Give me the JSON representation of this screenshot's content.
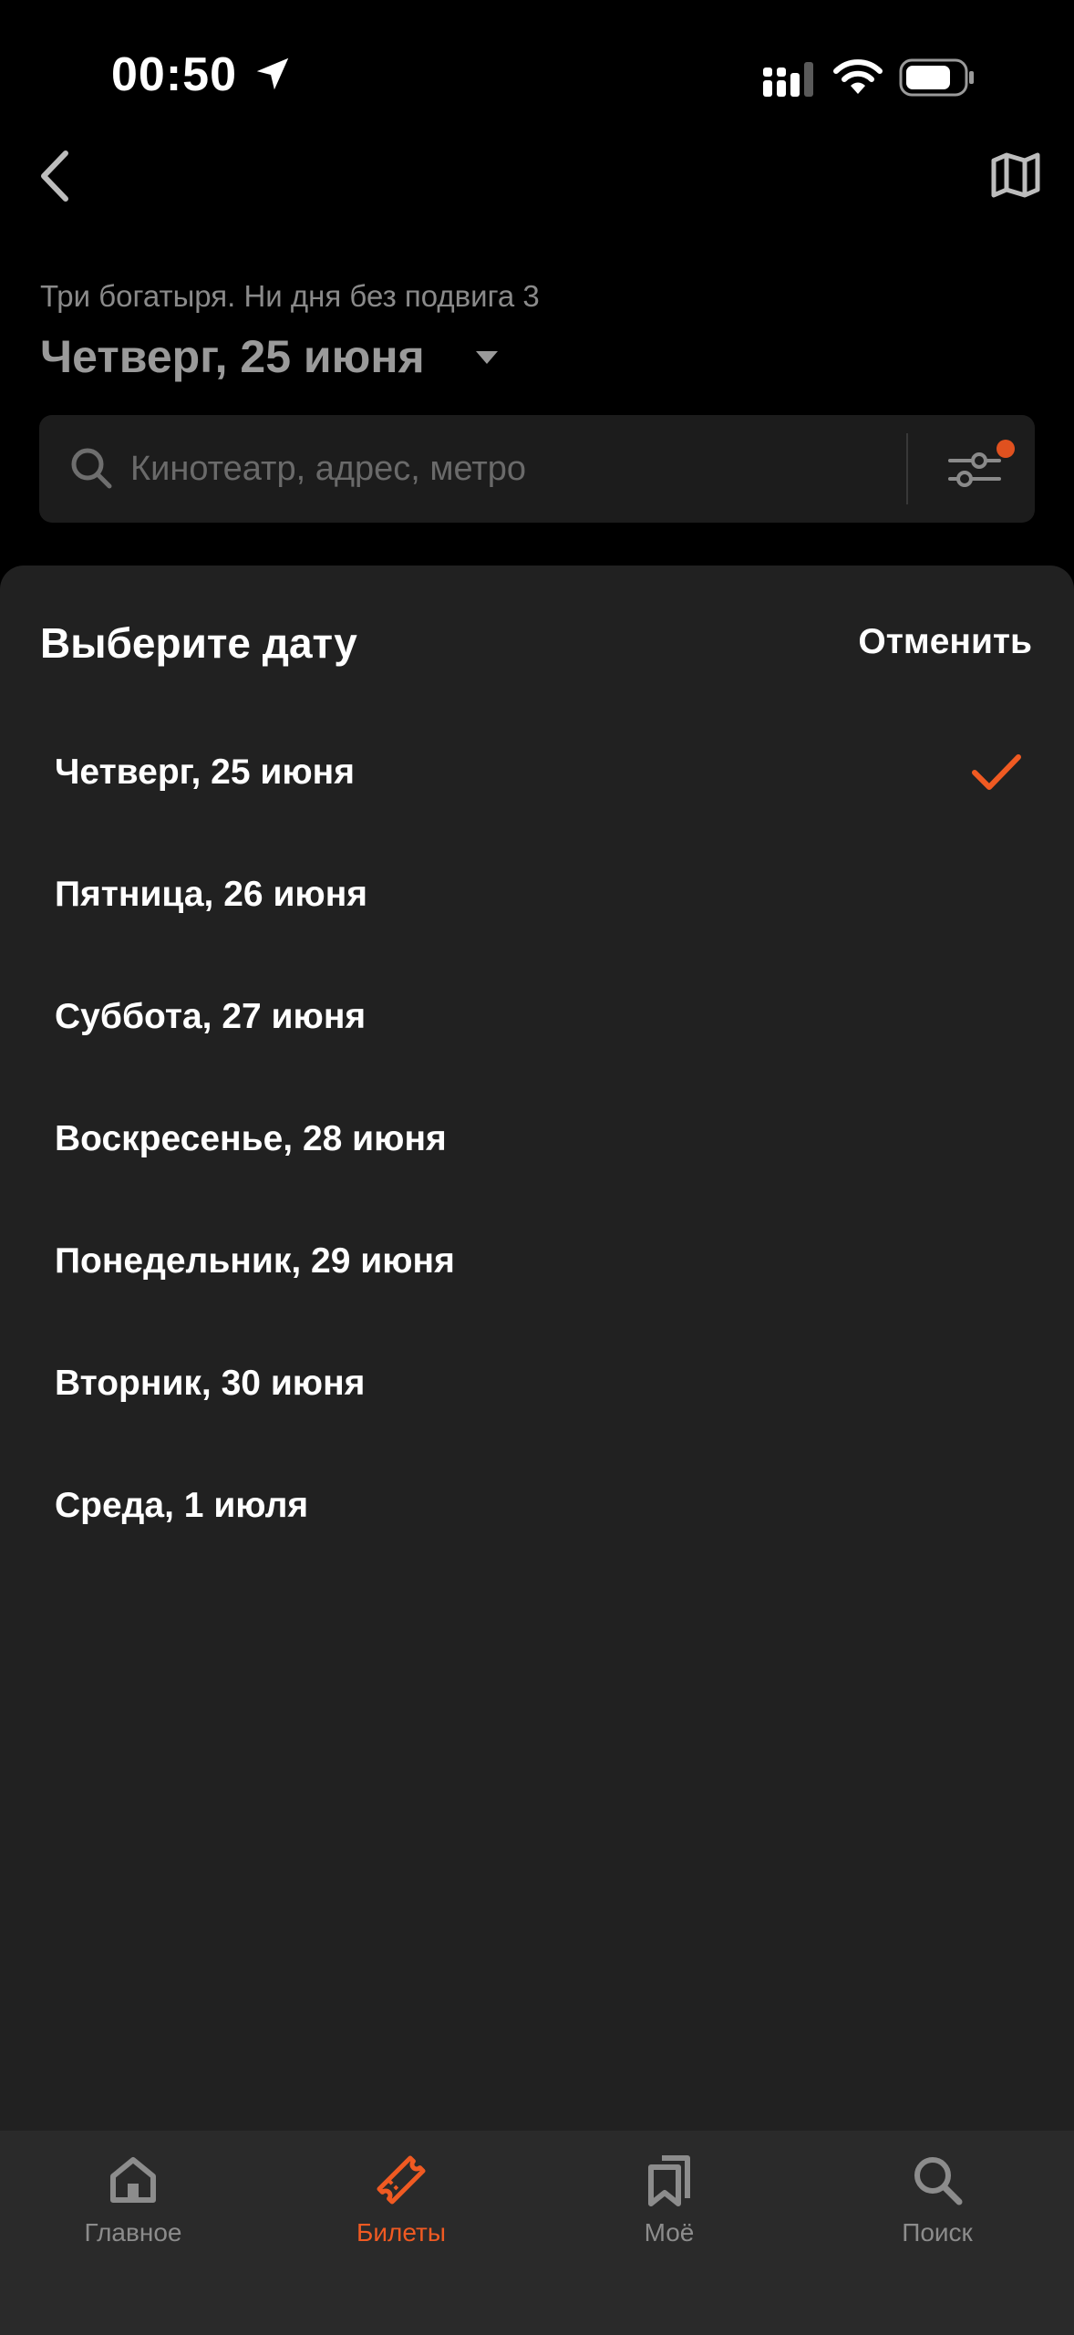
{
  "status_bar": {
    "time": "00:50"
  },
  "header": {
    "movie_title": "Три богатыря. Ни дня без подвига 3",
    "selected_date": "Четверг, 25 июня"
  },
  "search": {
    "placeholder": "Кинотеатр, адрес, метро",
    "value": ""
  },
  "date_sheet": {
    "title": "Выберите дату",
    "cancel_label": "Отменить",
    "dates": [
      {
        "label": "Четверг, 25 июня",
        "selected": true
      },
      {
        "label": "Пятница, 26 июня",
        "selected": false
      },
      {
        "label": "Суббота, 27 июня",
        "selected": false
      },
      {
        "label": "Воскресенье, 28 июня",
        "selected": false
      },
      {
        "label": "Понедельник, 29 июня",
        "selected": false
      },
      {
        "label": "Вторник, 30 июня",
        "selected": false
      },
      {
        "label": "Среда, 1 июля",
        "selected": false
      }
    ]
  },
  "tab_bar": {
    "tabs": [
      {
        "label": "Главное",
        "icon": "home-icon",
        "active": false
      },
      {
        "label": "Билеты",
        "icon": "ticket-icon",
        "active": true
      },
      {
        "label": "Моё",
        "icon": "bookmarks-icon",
        "active": false
      },
      {
        "label": "Поиск",
        "icon": "search-icon",
        "active": false
      }
    ]
  },
  "colors": {
    "accent": "#f05a22",
    "background": "#000000",
    "sheet": "#212121",
    "tab_bar": "#2a2a2a",
    "filter_dot": "#e0511f"
  }
}
